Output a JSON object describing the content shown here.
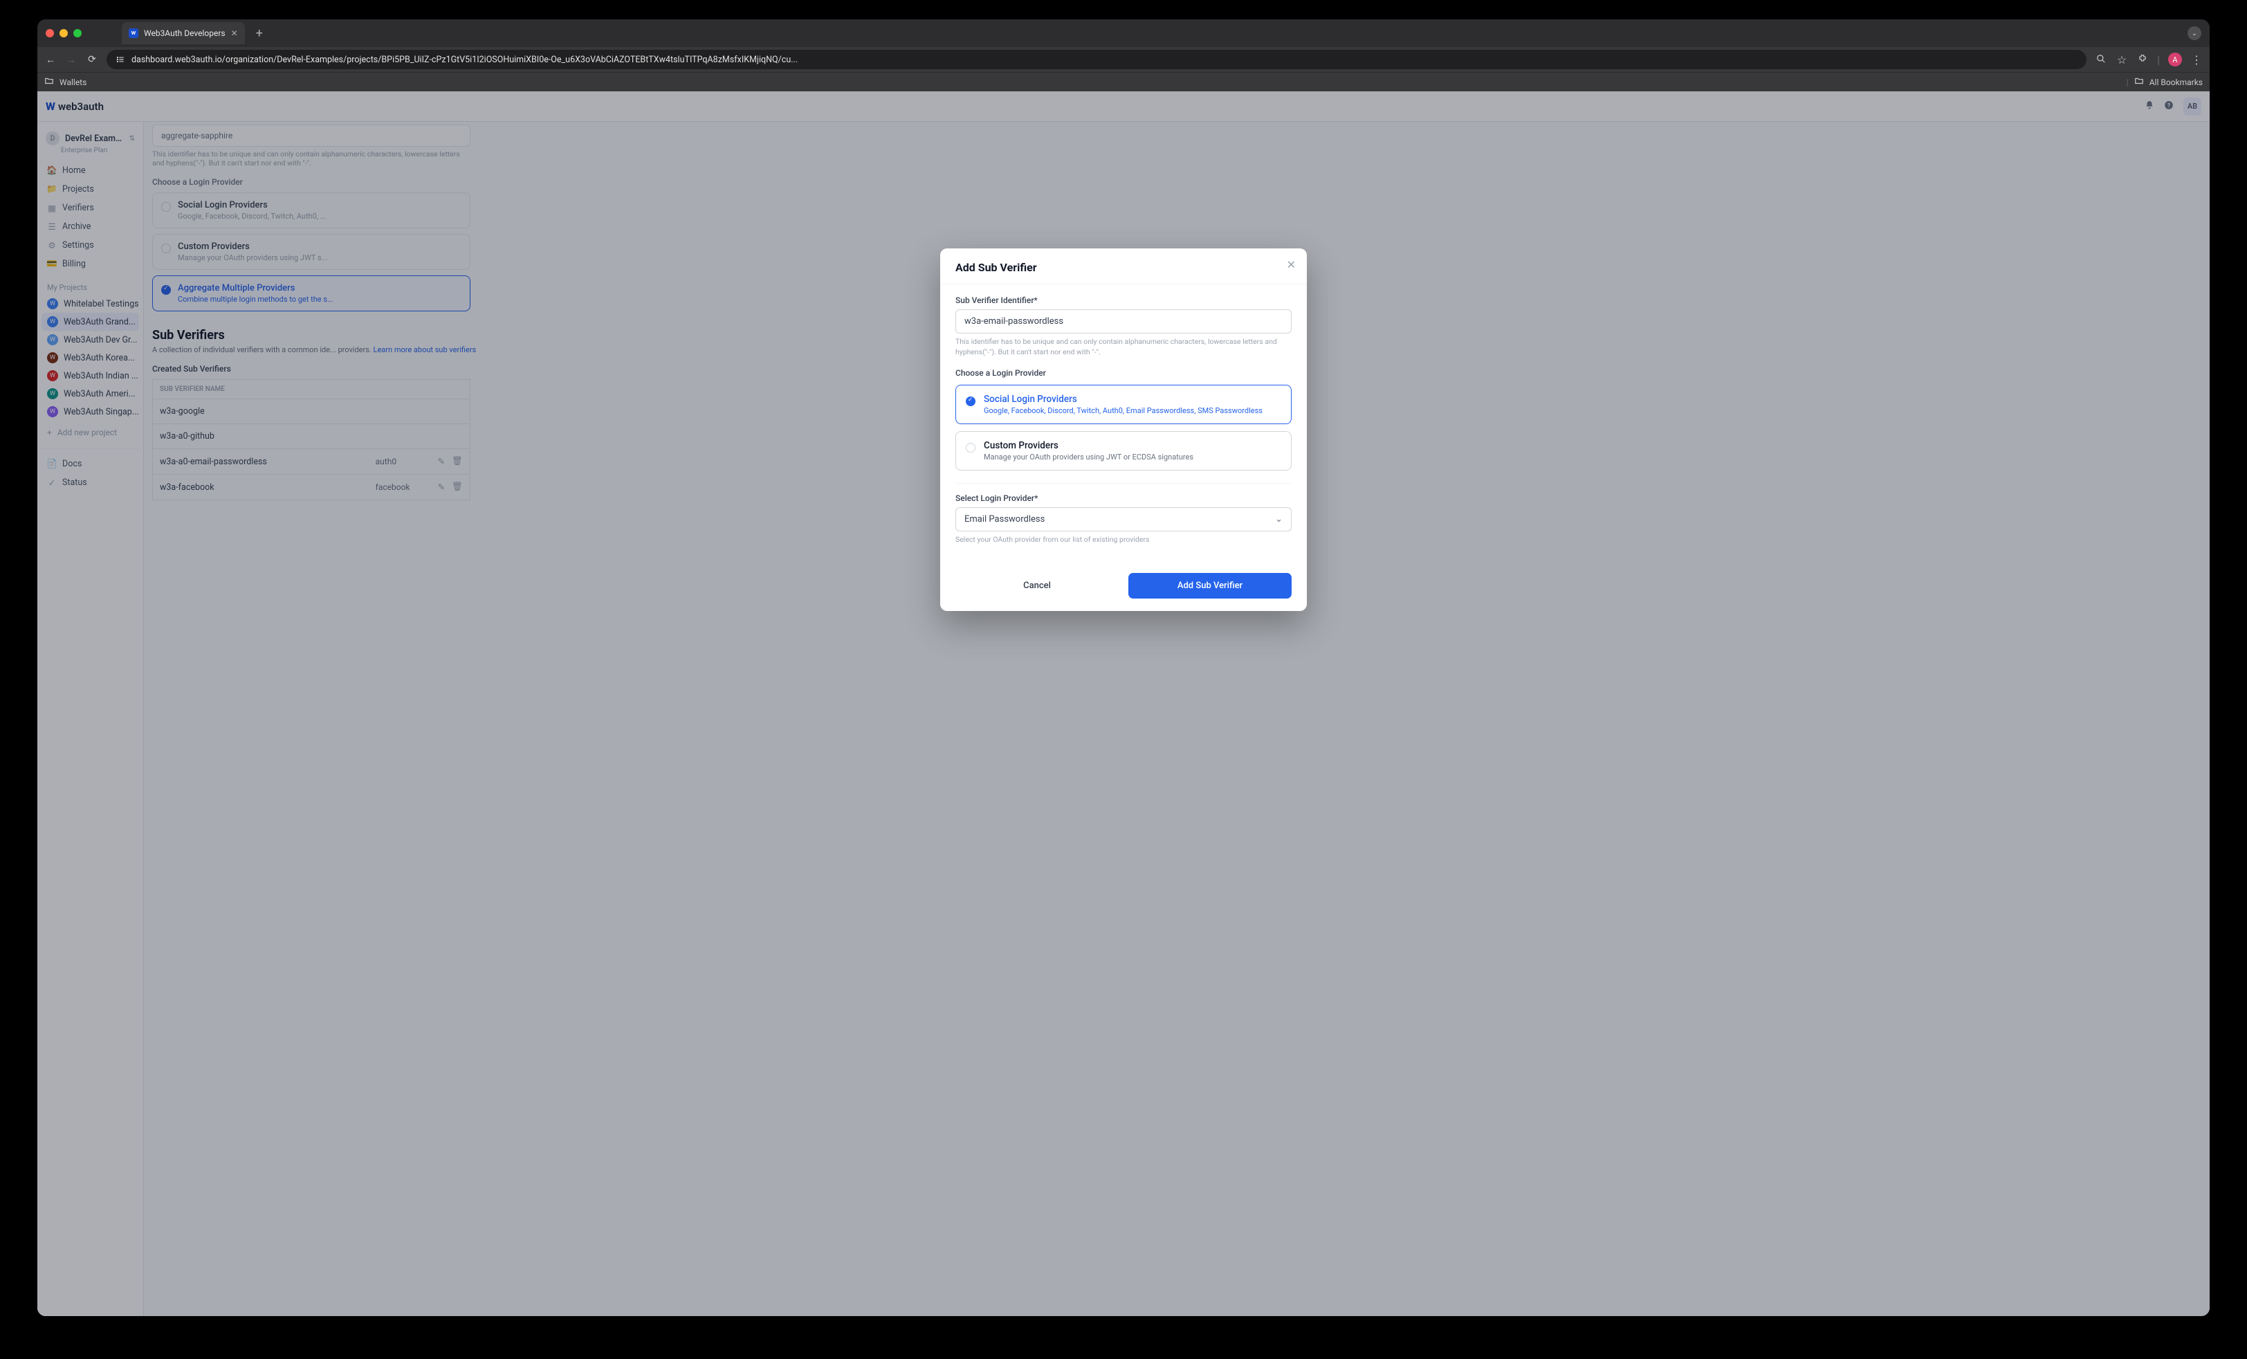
{
  "browser": {
    "tab_title": "Web3Auth Developers",
    "url_display": "dashboard.web3auth.io/organization/DevRel-Examples/projects/BPi5PB_UiIZ-cPz1GtV5i1I2iOSOHuimiXBI0e-Oe_u6X3oVAbCiAZOTEBtTXw4tsluTITPqA8zMsfxIKMjiqNQ/cu...",
    "bookmark_wallets": "Wallets",
    "all_bookmarks": "All Bookmarks",
    "avatar_letter": "A"
  },
  "topbar": {
    "brand": "web3auth",
    "user_initials": "AB"
  },
  "sidebar": {
    "org_badge": "D",
    "org_name": "DevRel Exampl...",
    "org_plan": "Enterprise Plan",
    "nav": {
      "home": "Home",
      "projects": "Projects",
      "verifiers": "Verifiers",
      "archive": "Archive",
      "settings": "Settings",
      "billing": "Billing"
    },
    "my_projects_label": "My Projects",
    "projects": [
      "Whitelabel Testings",
      "Web3Auth Grand...",
      "Web3Auth Dev Gr...",
      "Web3Auth Korea...",
      "Web3Auth Indian ...",
      "Web3Auth Ameri...",
      "Web3Auth Singap..."
    ],
    "add_project": "Add new project",
    "docs": "Docs",
    "status": "Status"
  },
  "main": {
    "identifier_value": "aggregate-sapphire",
    "identifier_help": "This identifier has to be unique and can only contain alphanumeric characters, lowercase letters and hyphens(\"-\"). But it can't start nor end with \"-\".",
    "choose_provider_label": "Choose a Login Provider",
    "social_title": "Social Login Providers",
    "social_sub": "Google, Facebook, Discord, Twitch, Auth0, ...",
    "custom_title": "Custom Providers",
    "custom_sub": "Manage your OAuth providers using JWT s...",
    "aggregate_title": "Aggregate Multiple Providers",
    "aggregate_sub": "Combine multiple login methods to get the s...",
    "sub_verifiers_heading": "Sub Verifiers",
    "sub_verifiers_desc": "A collection of individual verifiers with a common ide... providers. ",
    "learn_more": "Learn more about sub verifiers",
    "created_label": "Created Sub Verifiers",
    "table_header": "SUB VERIFIER NAME",
    "rows": [
      {
        "name": "w3a-google",
        "provider": ""
      },
      {
        "name": "w3a-a0-github",
        "provider": ""
      },
      {
        "name": "w3a-a0-email-passwordless",
        "provider": "auth0"
      },
      {
        "name": "w3a-facebook",
        "provider": "facebook"
      }
    ]
  },
  "modal": {
    "title": "Add Sub Verifier",
    "id_label": "Sub Verifier Identifier*",
    "id_value": "w3a-email-passwordless",
    "id_help": "This identifier has to be unique and can only contain alphanumeric characters, lowercase letters and hyphens(\"-\"). But it can't start nor end with \"-\".",
    "choose_label": "Choose a Login Provider",
    "social_title": "Social Login Providers",
    "social_sub": "Google, Facebook, Discord, Twitch, Auth0, Email Passwordless, SMS Passwordless",
    "custom_title": "Custom Providers",
    "custom_sub": "Manage your OAuth providers using JWT or ECDSA signatures",
    "select_label": "Select Login Provider*",
    "select_value": "Email Passwordless",
    "select_help": "Select your OAuth provider from our list of existing providers",
    "cancel": "Cancel",
    "submit": "Add Sub Verifier"
  }
}
